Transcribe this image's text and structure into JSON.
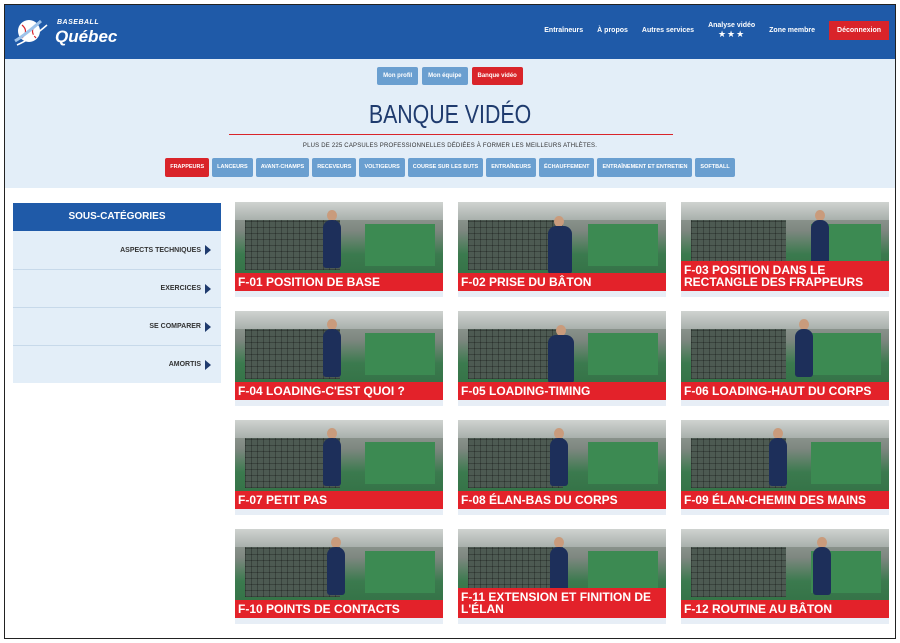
{
  "header": {
    "logo_small": "BASEBALL",
    "logo_big": "Québec",
    "nav": [
      "Entraîneurs",
      "À propos",
      "Autres services"
    ],
    "analyse_label": "Analyse vidéo",
    "analyse_stars": "★★★",
    "member_label": "Zone membre",
    "logout_label": "Déconnexion"
  },
  "subtabs": [
    {
      "label": "Mon profil",
      "active": false
    },
    {
      "label": "Mon équipe",
      "active": false
    },
    {
      "label": "Banque vidéo",
      "active": true
    }
  ],
  "page_title": "BANQUE VIDÉO",
  "tagline": "PLUS DE 225 CAPSULES PROFESSIONNELLES DÉDIÉES À FORMER LES MEILLEURS ATHLÈTES.",
  "categories": [
    {
      "label": "FRAPPEURS",
      "active": true
    },
    {
      "label": "LANCEURS",
      "active": false
    },
    {
      "label": "AVANT-CHAMPS",
      "active": false
    },
    {
      "label": "RECEVEURS",
      "active": false
    },
    {
      "label": "VOLTIGEURS",
      "active": false
    },
    {
      "label": "COURSE SUR LES BUTS",
      "active": false
    },
    {
      "label": "ENTRAÎNEURS",
      "active": false
    },
    {
      "label": "ÉCHAUFFEMENT",
      "active": false
    },
    {
      "label": "ENTRAÎNEMENT ET ENTRETIEN",
      "active": false
    },
    {
      "label": "SOFTBALL",
      "active": false
    }
  ],
  "sidebar": {
    "title": "SOUS-CATÉGORIES",
    "items": [
      "ASPECTS TECHNIQUES",
      "EXERCICES",
      "SE COMPARER",
      "AMORTIS"
    ]
  },
  "videos": [
    "F-01 POSITION DE BASE",
    "F-02 PRISE DU BÂTON",
    "F-03 POSITION DANS LE RECTANGLE DES FRAPPEURS",
    "F-04 LOADING-C'EST QUOI ?",
    "F-05 LOADING-TIMING",
    "F-06 LOADING-HAUT DU CORPS",
    "F-07 PETIT PAS",
    "F-08 ÉLAN-BAS DU CORPS",
    "F-09 ÉLAN-CHEMIN DES MAINS",
    "F-10 POINTS DE CONTACTS",
    "F-11 EXTENSION ET FINITION DE L'ÉLAN",
    "F-12 ROUTINE AU BÂTON"
  ],
  "colors": {
    "header_blue": "#1f5aa8",
    "accent_red": "#d9242a",
    "tab_blue": "#6a9fd0",
    "light_bg": "#e3eef8"
  }
}
